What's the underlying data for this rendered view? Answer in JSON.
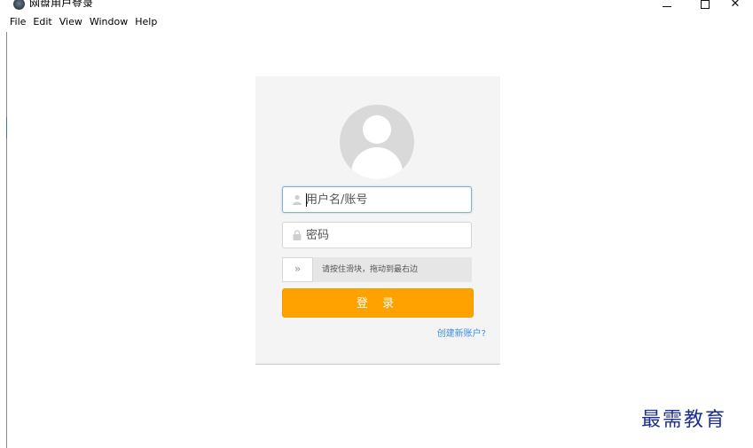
{
  "window": {
    "title": "网盘用户登录",
    "controls": {
      "minimize": "–",
      "maximize": "☐",
      "close": "✕"
    }
  },
  "menubar": {
    "items": [
      "File",
      "Edit",
      "View",
      "Window",
      "Help"
    ]
  },
  "login": {
    "username_placeholder": "用户名/账号",
    "password_placeholder": "密码",
    "slider_handle": "»",
    "slider_hint": "请按住滑块，拖动到最右边",
    "login_button": "登 录",
    "create_account": "创建新账户?"
  },
  "watermark": "最需教育",
  "colors": {
    "accent": "#ffa200",
    "link": "#3a8ee6",
    "card_bg": "#f4f4f4",
    "watermark": "#1e2f8f"
  }
}
